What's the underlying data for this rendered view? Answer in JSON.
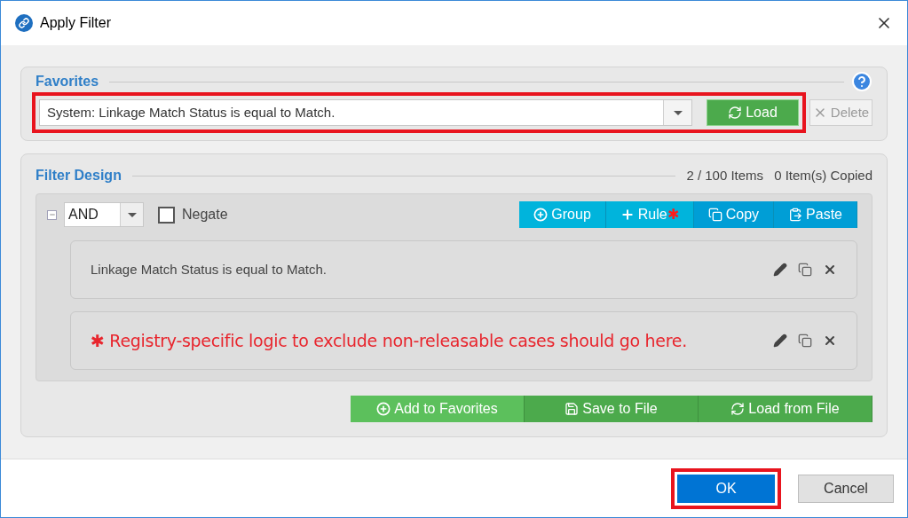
{
  "window": {
    "title": "Apply Filter"
  },
  "favorites": {
    "legend": "Favorites",
    "value": "System: Linkage Match Status is equal to Match.",
    "highlighted": true,
    "load_button": {
      "label": "Load"
    },
    "delete_button": {
      "label": "Delete",
      "disabled": true
    }
  },
  "filter_design": {
    "legend": "Filter Design",
    "item_count": "2 / 100 Items",
    "copied_count": "0 Item(s) Copied",
    "group": {
      "expanded": true,
      "operator": "AND",
      "negate": {
        "label": "Negate",
        "checked": false
      },
      "toolbar": [
        {
          "kind": "group",
          "label": "Group",
          "color": "#00b4dc"
        },
        {
          "kind": "rule",
          "label": "Rule",
          "badge": "✱",
          "color": "#00b4dc"
        },
        {
          "kind": "copy",
          "label": "Copy",
          "color": "#009ed6"
        },
        {
          "kind": "paste",
          "label": "Paste",
          "color": "#009ed6"
        }
      ],
      "rules": [
        {
          "kind": "rule",
          "text": "Linkage Match Status is equal to Match."
        },
        {
          "kind": "placeholder",
          "marker": "✱",
          "text": "Registry-specific logic to exclude non-releasable cases should go here."
        }
      ]
    },
    "file_buttons": [
      {
        "kind": "add",
        "label": "Add to Favorites",
        "color": "#5cc05c"
      },
      {
        "kind": "save",
        "label": "Save to File",
        "color": "#4caa4c"
      },
      {
        "kind": "load",
        "label": "Load from File",
        "color": "#4caa4c"
      }
    ]
  },
  "footer_buttons": [
    {
      "kind": "primary",
      "label": "OK",
      "highlighted": true
    },
    {
      "kind": "secondary",
      "label": "Cancel",
      "highlighted": false
    }
  ]
}
